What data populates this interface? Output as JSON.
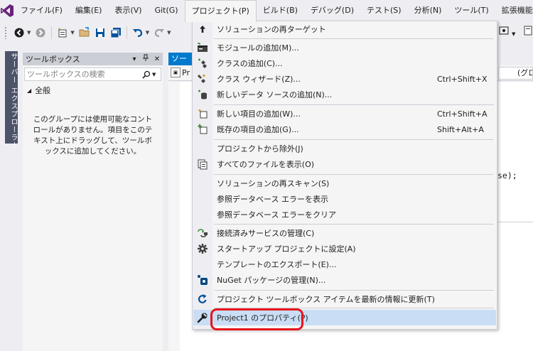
{
  "menubar": {
    "items": [
      {
        "label": "ファイル(F)"
      },
      {
        "label": "編集(E)"
      },
      {
        "label": "表示(V)"
      },
      {
        "label": "Git(G)"
      },
      {
        "label": "プロジェクト(P)"
      },
      {
        "label": "ビルド(B)"
      },
      {
        "label": "デバッグ(D)"
      },
      {
        "label": "テスト(S)"
      },
      {
        "label": "分析(N)"
      },
      {
        "label": "ツール(T)"
      },
      {
        "label": "拡張機能(X)"
      }
    ],
    "active_index": 4
  },
  "side_tab": {
    "label": "サーバー エクスプローラー"
  },
  "toolbox": {
    "title": "ツールボックス",
    "search_placeholder": "ツールボックスの検索",
    "group_label": "全般",
    "empty_message": "このグループには使用可能なコントロールがありません。項目をこのテキスト上にドラッグして、ツールボックスに追加してください。"
  },
  "editor": {
    "tab_label": "ソース",
    "bar_left": "Pr",
    "bar_right": "(グロ",
    "code_fragment": "se);"
  },
  "project_menu": {
    "items": [
      {
        "label": "ソリューションの再ターゲット",
        "shortcut": "",
        "icon": "up-arrow-icon"
      },
      {
        "label": "モジュールの追加(M)...",
        "shortcut": "",
        "icon": "module-icon"
      },
      {
        "label": "クラスの追加(C)...",
        "shortcut": "",
        "icon": "class-icon"
      },
      {
        "label": "クラス ウィザード(Z)...",
        "shortcut": "Ctrl+Shift+X",
        "icon": "class-wizard-icon"
      },
      {
        "label": "新しいデータ ソースの追加(N)...",
        "shortcut": "",
        "icon": "data-source-icon"
      },
      {
        "label": "新しい項目の追加(W)...",
        "shortcut": "Ctrl+Shift+A",
        "icon": "new-item-icon"
      },
      {
        "label": "既存の項目の追加(G)...",
        "shortcut": "Shift+Alt+A",
        "icon": "existing-item-icon"
      },
      {
        "label": "プロジェクトから除外(J)",
        "shortcut": "",
        "icon": ""
      },
      {
        "label": "すべてのファイルを表示(O)",
        "shortcut": "",
        "icon": "show-all-files-icon"
      },
      {
        "label": "ソリューションの再スキャン(S)",
        "shortcut": "",
        "icon": ""
      },
      {
        "label": "参照データベース エラーを表示",
        "shortcut": "",
        "icon": ""
      },
      {
        "label": "参照データベース エラーをクリア",
        "shortcut": "",
        "icon": ""
      },
      {
        "label": "接続済みサービスの管理(C)",
        "shortcut": "",
        "icon": "connected-services-icon"
      },
      {
        "label": "スタートアップ プロジェクトに設定(A)",
        "shortcut": "",
        "icon": "gear-icon"
      },
      {
        "label": "テンプレートのエクスポート(E)...",
        "shortcut": "",
        "icon": ""
      },
      {
        "label": "NuGet パッケージの管理(N)...",
        "shortcut": "",
        "icon": "nuget-icon"
      },
      {
        "label": "プロジェクト ツールボックス アイテムを最新の情報に更新(T)",
        "shortcut": "",
        "icon": "refresh-icon"
      },
      {
        "label": "Project1 のプロパティ(P)",
        "shortcut": "",
        "icon": "wrench-icon"
      }
    ],
    "highlighted_label": "Project1 のプロパティ(P)",
    "highlight_color": "#c9def5",
    "callout_color": "#e8141b"
  },
  "colors": {
    "accent": "#007acc",
    "menu_background": "#eeeef2",
    "dropdown_background": "#f5f5f5",
    "vs_logo": "#68217a"
  }
}
